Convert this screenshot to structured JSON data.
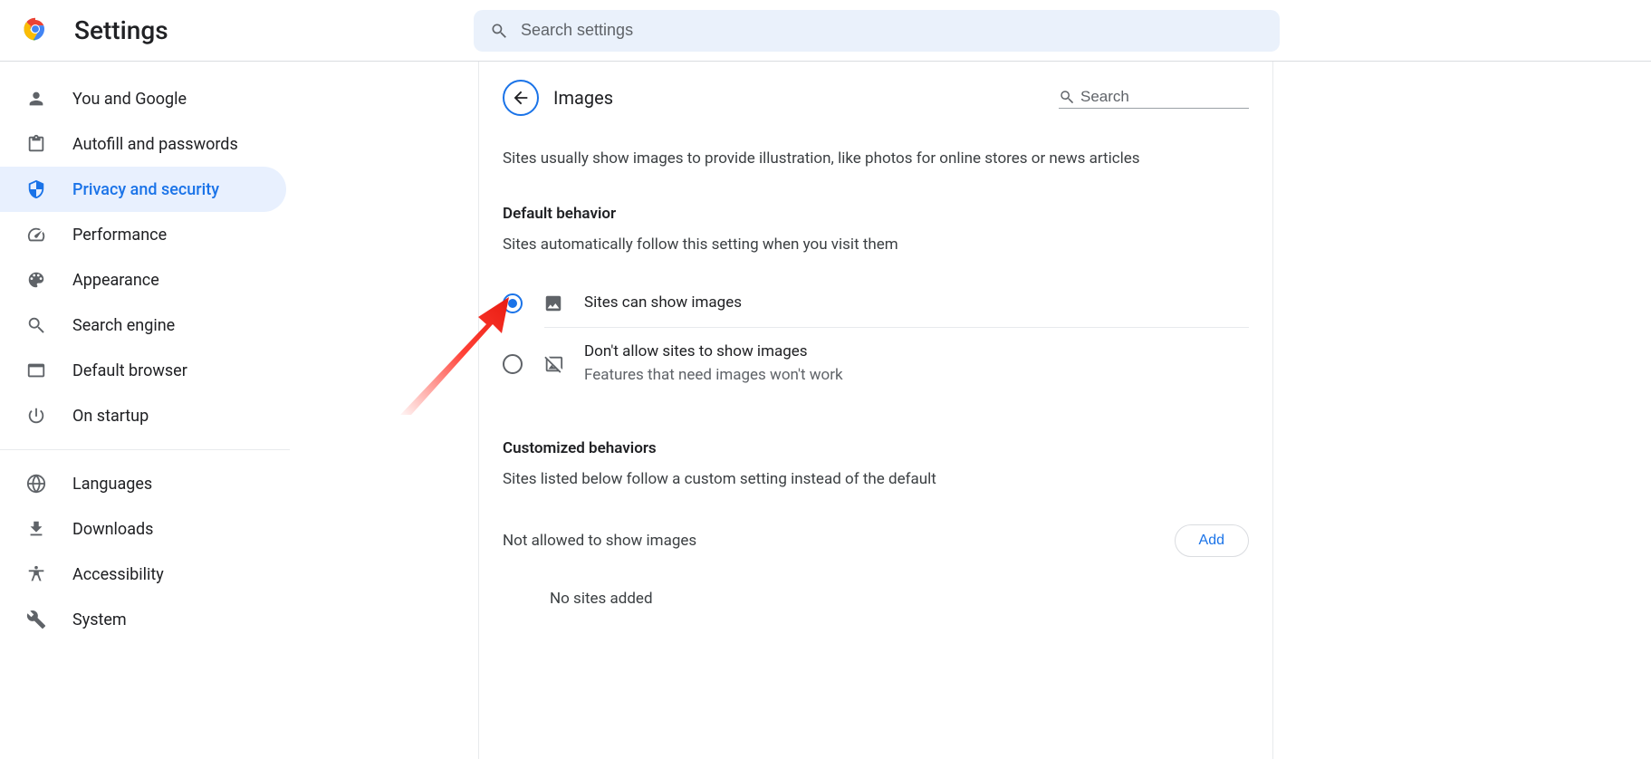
{
  "appTitle": "Settings",
  "topSearchPlaceholder": "Search settings",
  "sidebar": {
    "items": [
      {
        "id": "you",
        "label": "You and Google"
      },
      {
        "id": "autofill",
        "label": "Autofill and passwords"
      },
      {
        "id": "privacy",
        "label": "Privacy and security",
        "active": true
      },
      {
        "id": "performance",
        "label": "Performance"
      },
      {
        "id": "appearance",
        "label": "Appearance"
      },
      {
        "id": "search",
        "label": "Search engine"
      },
      {
        "id": "default",
        "label": "Default browser"
      },
      {
        "id": "startup",
        "label": "On startup"
      }
    ],
    "items2": [
      {
        "id": "languages",
        "label": "Languages"
      },
      {
        "id": "downloads",
        "label": "Downloads"
      },
      {
        "id": "accessibility",
        "label": "Accessibility"
      },
      {
        "id": "system",
        "label": "System"
      }
    ]
  },
  "page": {
    "title": "Images",
    "searchPlaceholder": "Search",
    "intro": "Sites usually show images to provide illustration, like photos for online stores or news articles",
    "defaultBehaviorHeading": "Default behavior",
    "defaultBehaviorSub": "Sites automatically follow this setting when you visit them",
    "options": {
      "allow": {
        "label": "Sites can show images",
        "checked": true
      },
      "block": {
        "label": "Don't allow sites to show images",
        "sub": "Features that need images won't work",
        "checked": false
      }
    },
    "customHeading": "Customized behaviors",
    "customSub": "Sites listed below follow a custom setting instead of the default",
    "notAllowedHeading": "Not allowed to show images",
    "addLabel": "Add",
    "noSites": "No sites added"
  }
}
